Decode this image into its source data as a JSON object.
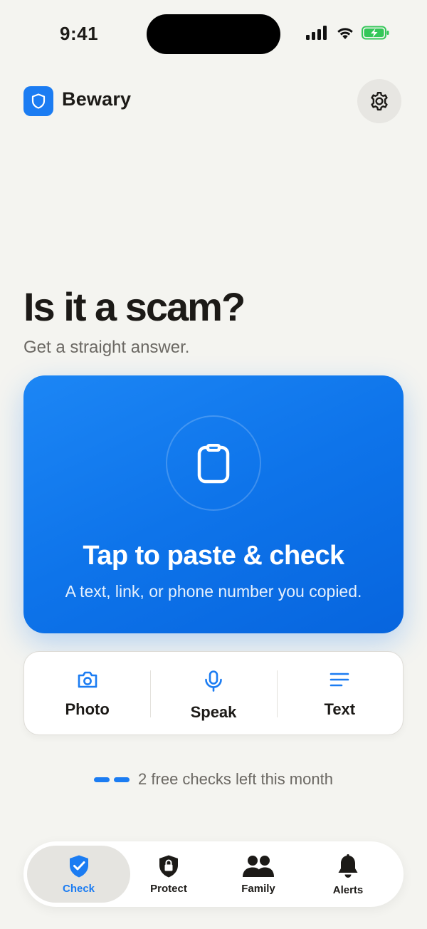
{
  "status_bar": {
    "time": "9:41"
  },
  "header": {
    "app_name": "Bewary",
    "logo_icon": "shield-icon",
    "settings_icon": "gear-icon"
  },
  "hero": {
    "title": "Is it a scam?",
    "subtitle": "Get a straight answer."
  },
  "paste_card": {
    "title": "Tap to paste & check",
    "subtitle": "A text, link, or phone number you copied.",
    "icon": "clipboard-icon"
  },
  "input_options": [
    {
      "label": "Photo",
      "icon": "camera-icon"
    },
    {
      "label": "Speak",
      "icon": "microphone-icon"
    },
    {
      "label": "Text",
      "icon": "text-lines-icon"
    }
  ],
  "quota": {
    "text": "2 free checks left this month",
    "remaining": 2
  },
  "tab_bar": {
    "tabs": [
      {
        "label": "Check",
        "icon": "shield-check-icon",
        "active": true
      },
      {
        "label": "Protect",
        "icon": "shield-lock-icon",
        "active": false
      },
      {
        "label": "Family",
        "icon": "people-icon",
        "active": false
      },
      {
        "label": "Alerts",
        "icon": "bell-icon",
        "active": false
      }
    ]
  },
  "colors": {
    "accent": "#1b7cf2",
    "background": "#f4f4f0",
    "text": "#1c1a17",
    "muted": "#6b6863",
    "battery": "#34c759"
  }
}
